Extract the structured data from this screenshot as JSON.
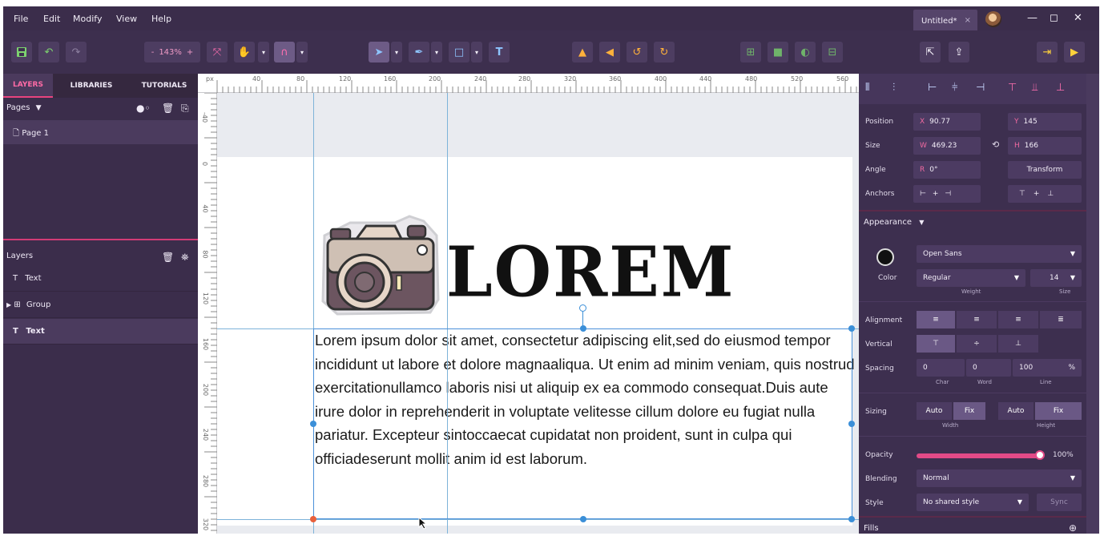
{
  "menu": [
    "File",
    "Edit",
    "Modify",
    "View",
    "Help"
  ],
  "document_tab": {
    "title": "Untitled*",
    "close": "×"
  },
  "window_controls": {
    "minimize": "—",
    "maximize": "◻",
    "close": "✕"
  },
  "toolbar": {
    "zoom_minus": "-",
    "zoom_value": "143%",
    "zoom_plus": "+"
  },
  "left_tabs": [
    "LAYERS",
    "LIBRARIES",
    "TUTORIALS"
  ],
  "pages": {
    "header": "Pages",
    "items": [
      "Page 1"
    ]
  },
  "layers": {
    "header": "Layers",
    "items": [
      {
        "label": "Text",
        "icon": "text-icon",
        "selected": false
      },
      {
        "label": "Group",
        "icon": "group-icon",
        "selected": false
      },
      {
        "label": "Text",
        "icon": "text-icon",
        "selected": true
      }
    ]
  },
  "rulers": {
    "unit": "px",
    "top": [
      "40",
      "80",
      "120",
      "160",
      "200",
      "240",
      "280",
      "320",
      "360",
      "400",
      "440",
      "480",
      "520",
      "560"
    ],
    "left": [
      "-40",
      "0",
      "40",
      "80",
      "120",
      "160",
      "200",
      "240",
      "280",
      "320"
    ]
  },
  "canvas": {
    "title": "LOREM",
    "body": "Lorem ipsum dolor sit amet, consectetur adipiscing elit,sed do eiusmod tempor incididunt ut labore et dolore magnaaliqua. Ut enim ad minim veniam, quis nostrud exercitationullamco laboris nisi ut aliquip ex ea commodo consequat.Duis aute irure dolor in reprehenderit in voluptate velitesse cillum dolore eu fugiat nulla pariatur. Excepteur sintoccaecat cupidatat non proident, sunt in culpa qui officiadeserunt mollit anim id est laborum."
  },
  "inspector": {
    "position": {
      "label": "Position",
      "x_prefix": "X",
      "x": "90.77",
      "y_prefix": "Y",
      "y": "145"
    },
    "size": {
      "label": "Size",
      "w_prefix": "W",
      "w": "469.23",
      "h_prefix": "H",
      "h": "166"
    },
    "angle": {
      "label": "Angle",
      "prefix": "R",
      "value": "0°",
      "transform": "Transform"
    },
    "anchors": {
      "label": "Anchors"
    },
    "appearance": {
      "title": "Appearance",
      "color_label": "Color",
      "font": "Open Sans",
      "weight": "Regular",
      "weight_label": "Weight",
      "size": "14",
      "size_label": "Size"
    },
    "alignment_label": "Alignment",
    "vertical_label": "Vertical",
    "spacing": {
      "label": "Spacing",
      "char": "0",
      "word": "0",
      "line": "100",
      "unit": "%",
      "char_label": "Char",
      "word_label": "Word",
      "line_label": "Line"
    },
    "sizing": {
      "label": "Sizing",
      "width_auto": "Auto",
      "width_fix": "Fix",
      "height_auto": "Auto",
      "height_fix": "Fix",
      "width_label": "Width",
      "height_label": "Height"
    },
    "opacity": {
      "label": "Opacity",
      "value": "100%",
      "level": 1.0
    },
    "blending": {
      "label": "Blending",
      "value": "Normal"
    },
    "style": {
      "label": "Style",
      "value": "No shared style",
      "sync": "Sync"
    },
    "fills": {
      "label": "Fills"
    }
  }
}
